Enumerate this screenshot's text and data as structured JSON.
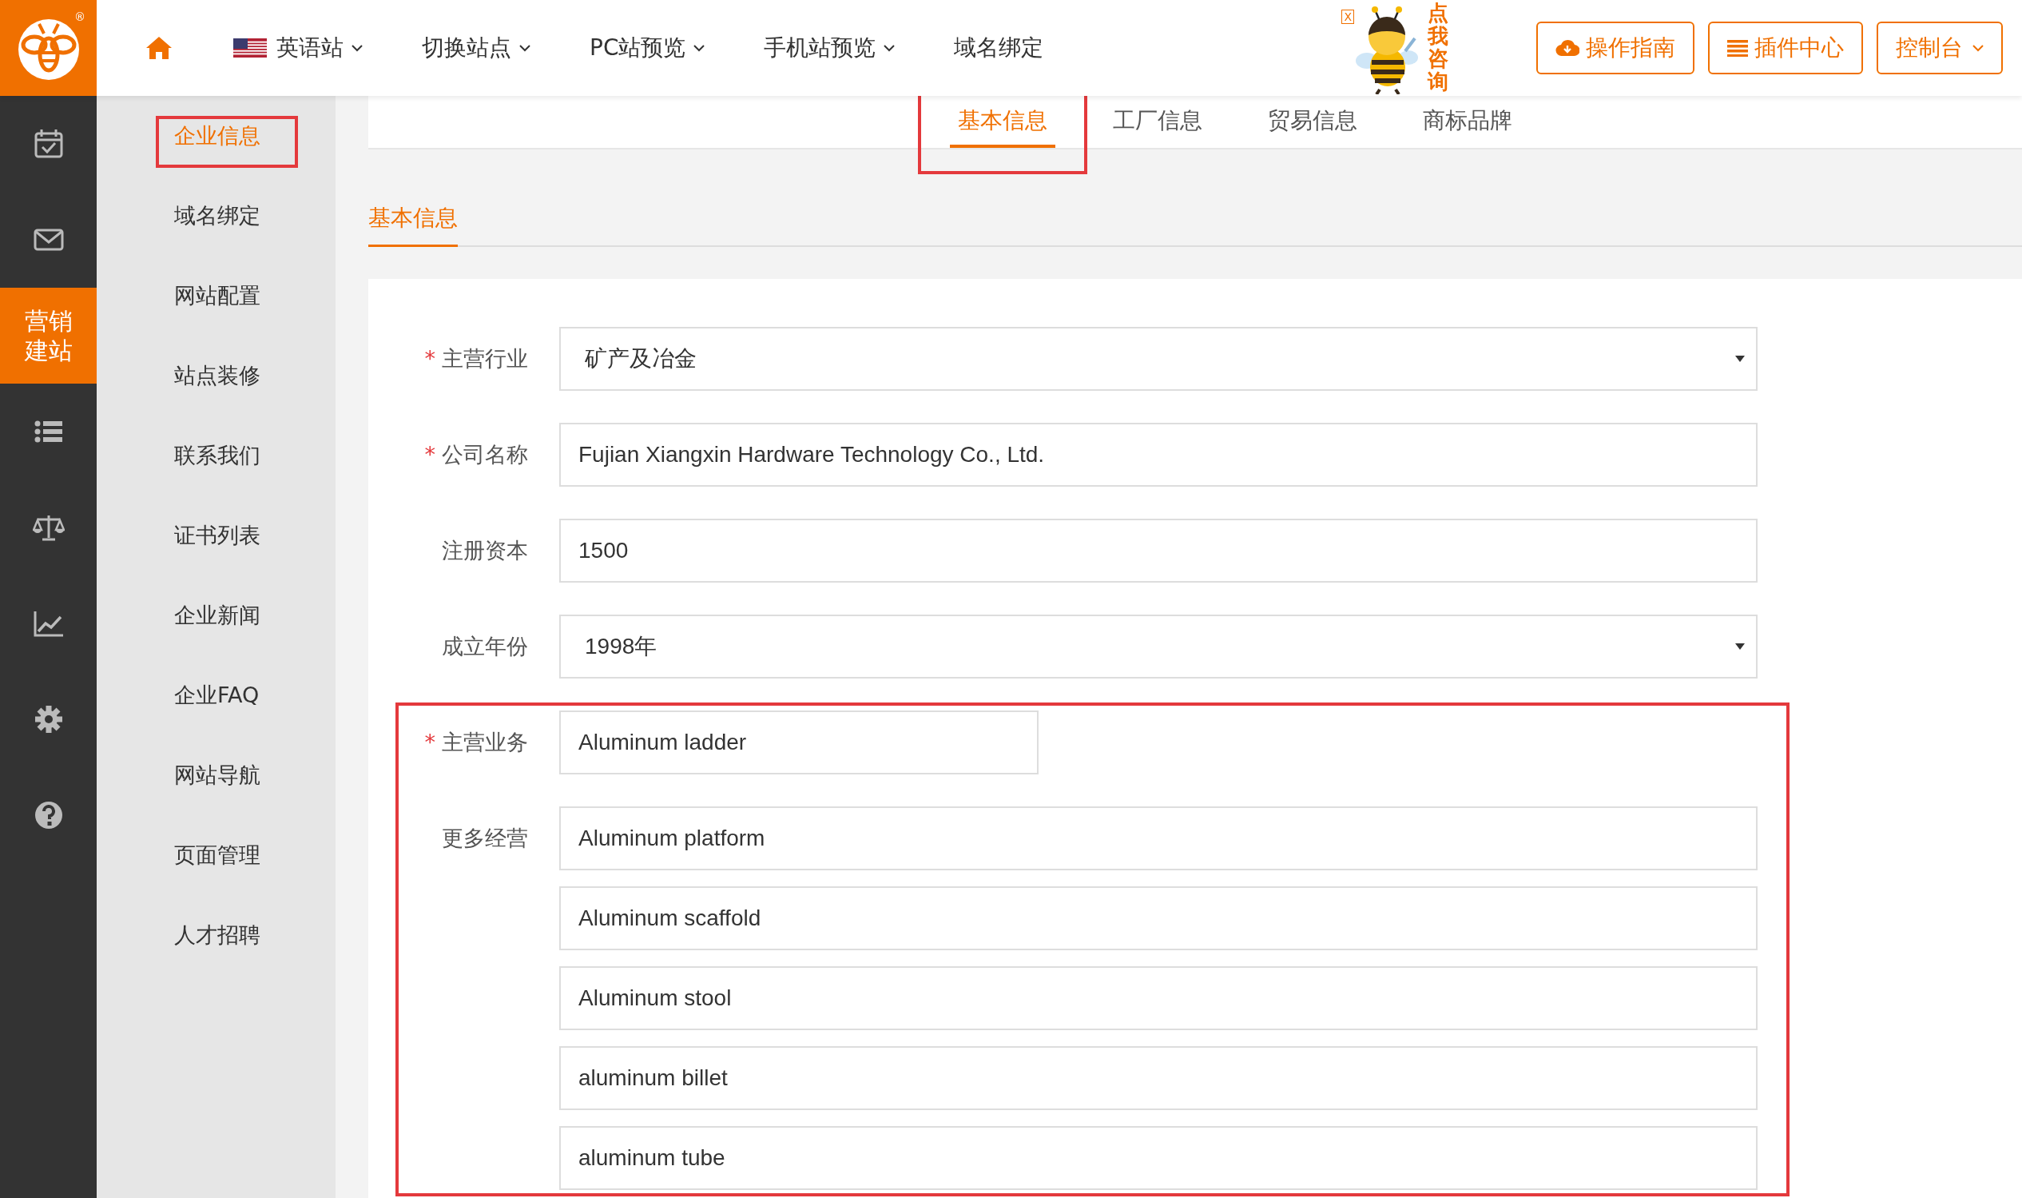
{
  "logo": {
    "mark": "®"
  },
  "nav": [
    {
      "kind": "home"
    },
    {
      "kind": "flag",
      "label": "英语站",
      "dropdown": true
    },
    {
      "kind": "text",
      "label": "切换站点",
      "dropdown": true
    },
    {
      "kind": "text",
      "label": "PC站预览",
      "dropdown": true
    },
    {
      "kind": "text",
      "label": "手机站预览",
      "dropdown": true
    },
    {
      "kind": "text",
      "label": "域名绑定",
      "dropdown": false
    }
  ],
  "assistant": {
    "close": "X",
    "caption": "点我咨询"
  },
  "header_buttons": [
    {
      "kind": "cloud",
      "label": "操作指南",
      "dropdown": false
    },
    {
      "kind": "list",
      "label": "插件中心",
      "dropdown": false
    },
    {
      "kind": "plain",
      "label": "控制台",
      "dropdown": true
    }
  ],
  "rail": [
    {
      "kind": "calendar",
      "selected": false
    },
    {
      "kind": "mail",
      "selected": false
    },
    {
      "kind": "text",
      "label": "营销建站",
      "selected": true
    },
    {
      "kind": "list",
      "selected": false
    },
    {
      "kind": "scale",
      "selected": false
    },
    {
      "kind": "chart",
      "selected": false
    },
    {
      "kind": "gear",
      "selected": false
    },
    {
      "kind": "help",
      "selected": false
    }
  ],
  "menu": [
    {
      "label": "企业信息",
      "selected": true,
      "annotated": true
    },
    {
      "label": "域名绑定",
      "selected": false,
      "annotated": false
    },
    {
      "label": "网站配置",
      "selected": false,
      "annotated": false
    },
    {
      "label": "站点装修",
      "selected": false,
      "annotated": false
    },
    {
      "label": "联系我们",
      "selected": false,
      "annotated": false
    },
    {
      "label": "证书列表",
      "selected": false,
      "annotated": false
    },
    {
      "label": "企业新闻",
      "selected": false,
      "annotated": false
    },
    {
      "label": "企业FAQ",
      "selected": false,
      "annotated": false
    },
    {
      "label": "网站导航",
      "selected": false,
      "annotated": false
    },
    {
      "label": "页面管理",
      "selected": false,
      "annotated": false
    },
    {
      "label": "人才招聘",
      "selected": false,
      "annotated": false
    }
  ],
  "tabs": [
    {
      "label": "基本信息",
      "selected": true,
      "annotated": true
    },
    {
      "label": "工厂信息",
      "selected": false,
      "annotated": false
    },
    {
      "label": "贸易信息",
      "selected": false,
      "annotated": false
    },
    {
      "label": "商标品牌",
      "selected": false,
      "annotated": false
    }
  ],
  "section_title": "基本信息",
  "form": {
    "groups": [
      {
        "annotated": false,
        "fields": [
          {
            "label": "主营行业",
            "required_mark": "*",
            "kind": "select",
            "value": "矿产及冶金"
          },
          {
            "label": "公司名称",
            "required_mark": "*",
            "kind": "input",
            "value": "Fujian Xiangxin Hardware Technology Co., Ltd."
          },
          {
            "label": "注册资本",
            "kind": "input",
            "value": "1500"
          },
          {
            "label": "成立年份",
            "kind": "select",
            "value": "1998年"
          }
        ]
      },
      {
        "annotated": true,
        "fields": [
          {
            "label": "主营业务",
            "required_mark": "*",
            "kind": "short",
            "value": "Aluminum ladder"
          },
          {
            "label": "更多经营",
            "kind": "input",
            "value": "Aluminum platform"
          },
          {
            "kind": "input",
            "value": "Aluminum scaffold"
          },
          {
            "kind": "input",
            "value": "Aluminum stool"
          },
          {
            "kind": "input",
            "value": "aluminum billet"
          },
          {
            "kind": "input",
            "value": "aluminum tube"
          }
        ]
      }
    ]
  }
}
